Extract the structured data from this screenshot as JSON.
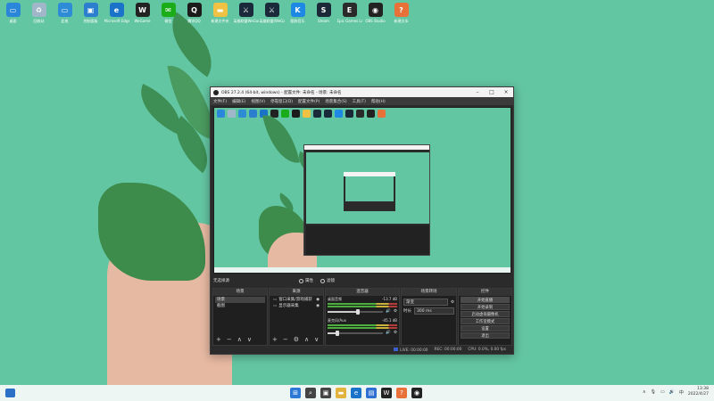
{
  "desktop": {
    "icons": [
      {
        "label": "桌面",
        "color": "#2a86d8",
        "glyph": "▭"
      },
      {
        "label": "回收站",
        "color": "#9fb7c9",
        "glyph": "♻"
      },
      {
        "label": "此电",
        "color": "#2e8bd6",
        "glyph": "▭"
      },
      {
        "label": "控制面板",
        "color": "#2b7fce",
        "glyph": "▣"
      },
      {
        "label": "Microsoft Edge",
        "color": "#1a73c8",
        "glyph": "e"
      },
      {
        "label": "WeGame",
        "color": "#222222",
        "glyph": "W"
      },
      {
        "label": "微信",
        "color": "#1aad19",
        "glyph": "✉"
      },
      {
        "label": "腾讯QQ",
        "color": "#1b1b1b",
        "glyph": "Q"
      },
      {
        "label": "新建文件夹",
        "color": "#f0c244",
        "glyph": "▬"
      },
      {
        "label": "英雄联盟WeGame",
        "color": "#1b2a3a",
        "glyph": "⚔"
      },
      {
        "label": "英雄联盟(WeGame版)",
        "color": "#1b2a3a",
        "glyph": "⚔"
      },
      {
        "label": "酷狗音乐",
        "color": "#1e88e5",
        "glyph": "K"
      },
      {
        "label": "Steam",
        "color": "#1b2838",
        "glyph": "S"
      },
      {
        "label": "Epic Games Launcher",
        "color": "#2a2a2a",
        "glyph": "E"
      },
      {
        "label": "OBS Studio",
        "color": "#222222",
        "glyph": "◉"
      },
      {
        "label": "新建文本",
        "color": "#e8713a",
        "glyph": "?"
      }
    ]
  },
  "obs": {
    "title": "OBS 27.2.4 (64-bit, windows) - 配置文件: 未命名 - 场景: 未命名",
    "menu": [
      "文件(F)",
      "编辑(E)",
      "视图(V)",
      "停靠窗口(D)",
      "配置文件(P)",
      "场景集合(S)",
      "工具(T)",
      "帮助(H)"
    ],
    "no_source": "无选择源",
    "properties_label": "属性",
    "filters_label": "滤镜",
    "docks": {
      "scenes": {
        "header": "场景",
        "items": [
          "场景",
          "截图"
        ]
      },
      "sources": {
        "header": "来源",
        "items": [
          "窗口采集/游戏捕获",
          "显示器采集"
        ]
      },
      "mixer": {
        "header": "混音器",
        "tracks": [
          {
            "name": "桌面音频",
            "db": "-13.7 dB",
            "level": 0.55
          },
          {
            "name": "麦克风/Aux",
            "db": "-45.1 dB",
            "level": 0.18
          }
        ]
      },
      "transitions": {
        "header": "场景转场",
        "type": "渐变",
        "duration_label": "时长",
        "duration": "300 ms"
      },
      "controls": {
        "header": "控件",
        "buttons": [
          "开始直播",
          "开始录制",
          "启动虚拟摄像机",
          "工作室模式",
          "设置",
          "退出"
        ]
      }
    },
    "status": {
      "live": "LIVE: 00:00:00",
      "rec": "REC: 00:00:00",
      "cpu": "CPU: 0.0%, 0.00 fps"
    }
  },
  "taskbar": {
    "apps": [
      {
        "name": "start",
        "color": "#2b78d6",
        "glyph": "⊞"
      },
      {
        "name": "search",
        "color": "#444444",
        "glyph": "⌕"
      },
      {
        "name": "task-view",
        "color": "#444444",
        "glyph": "▣"
      },
      {
        "name": "explorer",
        "color": "#e2b33d",
        "glyph": "▬"
      },
      {
        "name": "edge",
        "color": "#1a73c8",
        "glyph": "e"
      },
      {
        "name": "store",
        "color": "#2f6fd1",
        "glyph": "▤"
      },
      {
        "name": "wegame",
        "color": "#222222",
        "glyph": "W"
      },
      {
        "name": "app-orange",
        "color": "#e8713a",
        "glyph": "?"
      },
      {
        "name": "obs",
        "color": "#222222",
        "glyph": "◉"
      }
    ],
    "clock_time": "13:38",
    "clock_date": "2022/4/27"
  }
}
